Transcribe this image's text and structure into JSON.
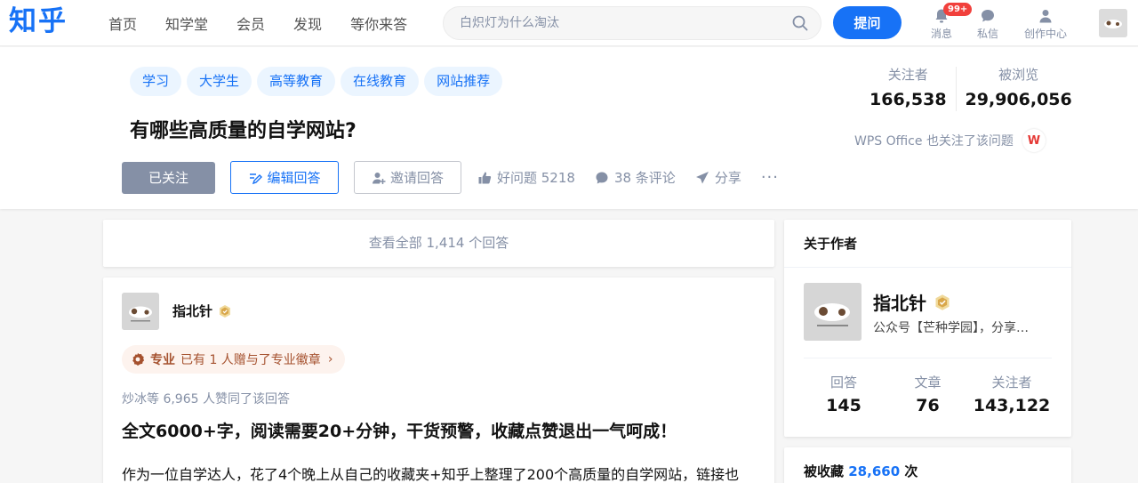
{
  "header": {
    "logo": "知乎",
    "nav": [
      "首页",
      "知学堂",
      "会员",
      "发现",
      "等你来答"
    ],
    "search_placeholder": "白炽灯为什么淘汰",
    "ask_label": "提问",
    "messages_label": "消息",
    "messages_badge": "99+",
    "dm_label": "私信",
    "creator_label": "创作中心"
  },
  "question": {
    "tags": [
      "学习",
      "大学生",
      "高等教育",
      "在线教育",
      "网站推荐"
    ],
    "title": "有哪些高质量的自学网站?",
    "followers_label": "关注者",
    "followers": "166,538",
    "views_label": "被浏览",
    "views": "29,906,056",
    "wps_note": "WPS Office 也关注了该问题",
    "wps_logo": "W",
    "followed_label": "已关注",
    "edit_answer_label": "编辑回答",
    "invite_label": "邀请回答",
    "good_question_label": "好问题 5218",
    "comments_label": "38 条评论",
    "share_label": "分享",
    "more_label": "···"
  },
  "main": {
    "view_all_label": "查看全部 1,414 个回答",
    "answer": {
      "author": "指北针",
      "pro_label": "专业",
      "pro_text": "已有 1 人赠与了专业徽章",
      "upvoters": "炒冰等 6,965 人赞同了该回答",
      "headline": "全文6000+字，阅读需要20+分钟，干货预警，收藏点赞退出一气呵成！",
      "body": "作为一位自学达人，花了4个晚上从自己的收藏夹+知乎上整理了200个高质量的自学网站，链接也"
    }
  },
  "sidebar": {
    "title": "关于作者",
    "name": "指北针",
    "desc": "公众号【芒种学园】，分享…",
    "stats": [
      {
        "label": "回答",
        "value": "145"
      },
      {
        "label": "文章",
        "value": "76"
      },
      {
        "label": "关注者",
        "value": "143,122"
      }
    ],
    "collected_label": "被收藏",
    "collected_count": "28,660",
    "collected_unit": "次"
  },
  "colors": {
    "brand": "#1772f6",
    "muted": "#8590a6",
    "badge": "#f1403c",
    "pro": "#a5512e"
  }
}
